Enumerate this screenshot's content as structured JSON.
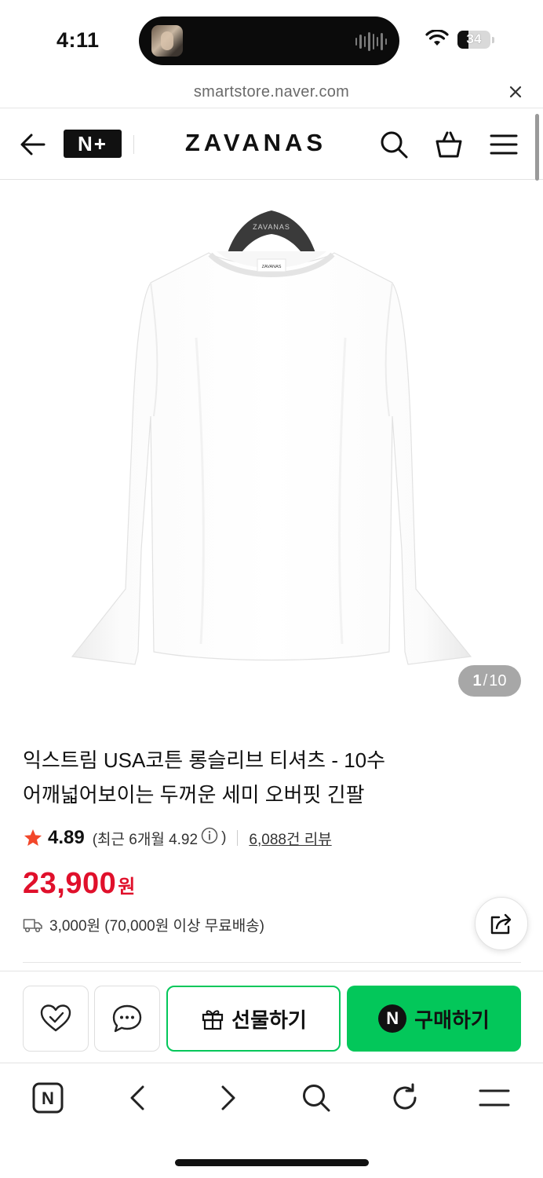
{
  "status_bar": {
    "time": "4:11",
    "battery": "34"
  },
  "browser": {
    "url": "smartstore.naver.com"
  },
  "header": {
    "badge": "N+",
    "brand": "ZAVANAS"
  },
  "gallery": {
    "current": "1",
    "separator": "/",
    "total": "10",
    "hanger_text": "ZAVANAS",
    "tag_text": "ZAVANAS"
  },
  "product": {
    "title_line1": "익스트림 USA코튼 롱슬리브 티셔츠 - 10수",
    "title_line2": "어깨넓어보이는 두꺼운 세미 오버핏 긴팔",
    "rating": "4.89",
    "recent_prefix": "(최근 6개월 4.92",
    "recent_suffix": ")",
    "review_count": "6,088건 리뷰",
    "price": "23,900",
    "currency": "원",
    "shipping": "3,000원 (70,000원 이상 무료배송)"
  },
  "actions": {
    "gift_label": "선물하기",
    "buy_label": "구매하기",
    "buy_logo": "N"
  },
  "toolbar": {
    "home_logo": "N"
  },
  "colors": {
    "accent_green": "#03c75a",
    "price_red": "#e0102b",
    "star": "#f2472a"
  }
}
